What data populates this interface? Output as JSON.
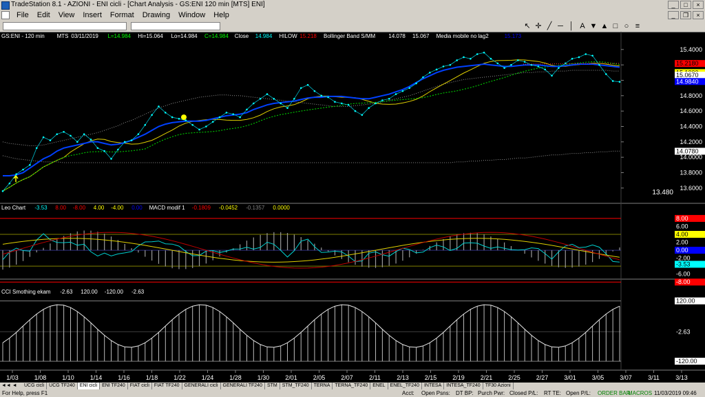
{
  "window": {
    "title": "TradeStation 8.1 - AZIONI - ENI cicli - [Chart Analysis - GS:ENI  120 min  [MTS] ENI]"
  },
  "menu": [
    "File",
    "Edit",
    "View",
    "Insert",
    "Format",
    "Drawing",
    "Window",
    "Help"
  ],
  "price_panel": {
    "header": [
      {
        "text": "GS:ENI - 120 min",
        "color": "#ffffff"
      },
      {
        "text": "MTS",
        "color": "#ffffff"
      },
      {
        "text": "03/11/2019",
        "color": "#ffffff"
      },
      {
        "text": "L=14.984",
        "color": "#00ff00"
      },
      {
        "text": "Hi=15.064",
        "color": "#ffffff"
      },
      {
        "text": "Lo=14.984",
        "color": "#ffffff"
      },
      {
        "text": "C=14.984",
        "color": "#00ff00"
      },
      {
        "text": "Close",
        "color": "#ffffff"
      },
      {
        "text": "14.984",
        "color": "#00ffff"
      },
      {
        "text": "HILOW",
        "color": "#ffffff"
      },
      {
        "text": "15.218",
        "color": "#ff0000"
      },
      {
        "text": "Bollinger Band S/MM",
        "color": "#ffffff"
      },
      {
        "text": "14.078",
        "color": "#ffffff"
      },
      {
        "text": "15.067",
        "color": "#ffffff"
      },
      {
        "text": "Media mobile no lag2",
        "color": "#ffffff"
      },
      {
        "text": "15.173",
        "color": "#0000ff"
      }
    ],
    "axis_ticks": [
      "15.4000",
      "15.2000",
      "15.0000",
      "14.8000",
      "14.6000",
      "14.4000",
      "14.2000",
      "14.0000",
      "13.8000",
      "13.6000"
    ],
    "markers": [
      {
        "text": "15.2180",
        "bg": "#ff0000",
        "fg": "#000000"
      },
      {
        "text": "15.1000",
        "bg": "#ffff00",
        "fg": "#000000"
      },
      {
        "text": "15.0670",
        "bg": "#ffffff",
        "fg": "#000000"
      },
      {
        "text": "14.9840",
        "bg": "#0000ff",
        "fg": "#ffffff"
      },
      {
        "text": "14.0780",
        "bg": "#ffffff",
        "fg": "#000000"
      }
    ],
    "bottom_label": "13.480"
  },
  "leo_panel": {
    "header": [
      {
        "text": "Leo Chart",
        "color": "#ffffff"
      },
      {
        "text": "-3.53",
        "color": "#00ffff"
      },
      {
        "text": "8.00",
        "color": "#ff0000"
      },
      {
        "text": "-8.00",
        "color": "#ff0000"
      },
      {
        "text": "4.00",
        "color": "#ffff00"
      },
      {
        "text": "-4.00",
        "color": "#ffff00"
      },
      {
        "text": "0.00",
        "color": "#0000ff"
      },
      {
        "text": "MACD modif 1",
        "color": "#ffffff"
      },
      {
        "text": "-0.1809",
        "color": "#ff0000"
      },
      {
        "text": "-0.0452",
        "color": "#ffff00"
      },
      {
        "text": "-0.1357",
        "color": "#808080"
      },
      {
        "text": "0.0000",
        "color": "#ffff00"
      }
    ],
    "markers": [
      {
        "text": "8.00",
        "bg": "#ff0000",
        "fg": "#ffffff"
      },
      {
        "text": "6.00",
        "bg": "#000000",
        "fg": "#ffffff"
      },
      {
        "text": "4.00",
        "bg": "#ffff00",
        "fg": "#000000"
      },
      {
        "text": "2.00",
        "bg": "#000000",
        "fg": "#ffffff"
      },
      {
        "text": "0.00",
        "bg": "#0000ff",
        "fg": "#ffffff"
      },
      {
        "text": "-2.00",
        "bg": "#000000",
        "fg": "#ffffff"
      },
      {
        "text": "-3.53",
        "bg": "#00ffff",
        "fg": "#000000"
      },
      {
        "text": "-6.00",
        "bg": "#000000",
        "fg": "#ffffff"
      },
      {
        "text": "-8.00",
        "bg": "#ff0000",
        "fg": "#ffffff"
      }
    ]
  },
  "cci_panel": {
    "header": [
      {
        "text": "CCI Smothing ekam",
        "color": "#ffffff"
      },
      {
        "text": "-2.63",
        "color": "#ffffff"
      },
      {
        "text": "120.00",
        "color": "#ffffff"
      },
      {
        "text": "-120.00",
        "color": "#ffffff"
      },
      {
        "text": "-2.63",
        "color": "#ffffff"
      }
    ],
    "markers": [
      {
        "text": "120.00",
        "bg": "#ffffff",
        "fg": "#000000"
      },
      {
        "text": "-2.63",
        "bg": "#000000",
        "fg": "#ffffff"
      },
      {
        "text": "-120.00",
        "bg": "#ffffff",
        "fg": "#000000"
      }
    ]
  },
  "date_ticks": [
    "1/03",
    "1/08",
    "1/10",
    "1/14",
    "1/16",
    "1/18",
    "1/22",
    "1/24",
    "1/28",
    "1/30",
    "2/01",
    "2/05",
    "2/07",
    "2/11",
    "2/13",
    "2/15",
    "2/19",
    "2/21",
    "2/25",
    "2/27",
    "3/01",
    "3/05",
    "3/07",
    "3/11",
    "3/13"
  ],
  "tabs": [
    "UCG cicli",
    "UCG TF240",
    "ENI cicli",
    "ENI TF240",
    "FIAT cicli",
    "FIAT TF240",
    "GENERALI cicli",
    "GENERALI TF240",
    "STM",
    "STM_TF240",
    "TERNA",
    "TERNA_TF240",
    "ENEL",
    "ENEL_TF240",
    "INTESA",
    "INTESA_TF240",
    "TF30 Azioni"
  ],
  "active_tab": "ENI cicli",
  "status": {
    "help": "For Help, press F1",
    "acct": "Acct:",
    "open_psns": "Open Psns:",
    "dt_bp": "DT BP:",
    "purch_pwr": "Purch Pwr:",
    "closed_pl": "Closed P/L:",
    "rt_te": "RT TE:",
    "open_pl": "Open P/L:",
    "order_bar": "ORDER BAR",
    "macros": "MACROS",
    "clock": "11/03/2019 09:46"
  },
  "chart_data": {
    "type": "line",
    "price_close": [
      13.56,
      13.66,
      13.78,
      13.84,
      13.9,
      14.12,
      14.26,
      14.22,
      14.3,
      14.33,
      14.28,
      14.2,
      14.3,
      14.23,
      14.12,
      14.08,
      13.98,
      14.1,
      14.2,
      14.22,
      14.3,
      14.42,
      14.55,
      14.66,
      14.58,
      14.52,
      14.5,
      14.48,
      14.42,
      14.36,
      14.4,
      14.46,
      14.52,
      14.58,
      14.56,
      14.52,
      14.62,
      14.7,
      14.76,
      14.82,
      14.76,
      14.7,
      14.64,
      14.76,
      14.9,
      14.94,
      14.86,
      14.8,
      14.78,
      14.72,
      14.7,
      14.68,
      14.6,
      14.55,
      14.64,
      14.7,
      14.74,
      14.76,
      14.82,
      14.86,
      14.9,
      14.96,
      15.04,
      15.1,
      15.14,
      15.18,
      15.2,
      15.26,
      15.3,
      15.28,
      15.34,
      15.36,
      15.28,
      15.22,
      15.16,
      15.2,
      15.26,
      15.24,
      15.2,
      15.18,
      15.14,
      15.06,
      15.16,
      15.22,
      15.28,
      15.3,
      15.34,
      15.32,
      15.2,
      15.08,
      14.99,
      14.98
    ],
    "mm_nolag": [
      13.76,
      13.76,
      13.77,
      13.8,
      13.86,
      13.92,
      13.98,
      14.02,
      14.08,
      14.12,
      14.14,
      14.16,
      14.18,
      14.2,
      14.2,
      14.18,
      14.16,
      14.17,
      14.19,
      14.22,
      14.26,
      14.3,
      14.35,
      14.4,
      14.43,
      14.45,
      14.46,
      14.47,
      14.47,
      14.47,
      14.48,
      14.5,
      14.52,
      14.54,
      14.55,
      14.56,
      14.58,
      14.62,
      14.65,
      14.68,
      14.7,
      14.71,
      14.72,
      14.73,
      14.75,
      14.77,
      14.78,
      14.78,
      14.79,
      14.79,
      14.79,
      14.78,
      14.77,
      14.76,
      14.76,
      14.78,
      14.8,
      14.82,
      14.85,
      14.88,
      14.92,
      14.97,
      15.02,
      15.06,
      15.1,
      15.13,
      15.15,
      15.17,
      15.18,
      15.19,
      15.2,
      15.21,
      15.2,
      15.19,
      15.18,
      15.18,
      15.19,
      15.2,
      15.2,
      15.2,
      15.19,
      15.18,
      15.18,
      15.19,
      15.2,
      15.21,
      15.21,
      15.21,
      15.2,
      15.19,
      15.18,
      15.17
    ],
    "bb_upper": [
      14.2,
      14.18,
      14.17,
      14.16,
      14.15,
      14.15,
      14.16,
      14.18,
      14.2,
      14.22,
      14.24,
      14.26,
      14.28,
      14.3,
      14.32,
      14.35,
      14.38,
      14.41,
      14.45,
      14.48,
      14.52,
      14.56,
      14.6,
      14.64,
      14.67,
      14.7,
      14.72,
      14.74,
      14.76,
      14.78,
      14.79,
      14.8,
      14.81,
      14.81,
      14.8,
      14.8,
      14.79,
      14.78,
      14.77,
      14.76,
      14.75,
      14.74,
      14.73,
      14.72,
      14.71,
      14.7,
      14.69,
      14.68,
      14.67,
      14.66,
      14.66,
      14.66,
      14.67,
      14.68,
      14.69,
      14.7,
      14.72,
      14.74,
      14.76,
      14.78,
      14.8,
      14.83,
      14.86,
      14.89,
      14.92,
      14.95,
      14.97,
      14.99,
      15.01,
      15.02,
      15.03,
      15.04,
      15.05,
      15.06,
      15.07,
      15.08,
      15.09,
      15.1,
      15.1,
      15.11,
      15.11,
      15.12,
      15.12,
      15.12,
      15.13,
      15.13,
      15.13,
      15.13,
      15.13,
      15.13,
      15.12,
      15.12
    ],
    "bb_lower": [
      14.02,
      14.0,
      13.98,
      13.97,
      13.96,
      13.95,
      13.94,
      13.94,
      13.94,
      13.93,
      13.93,
      13.93,
      13.93,
      13.93,
      13.93,
      13.93,
      13.93,
      13.93,
      13.93,
      13.93,
      13.93,
      13.93,
      13.93,
      13.93,
      13.93,
      13.93,
      13.93,
      13.93,
      13.93,
      13.93,
      13.93,
      13.93,
      13.93,
      13.93,
      13.93,
      13.93,
      13.93,
      13.93,
      13.93,
      13.93,
      13.93,
      13.93,
      13.93,
      13.93,
      13.93,
      13.93,
      13.93,
      13.93,
      13.93,
      13.93,
      13.93,
      13.93,
      13.93,
      13.93,
      13.93,
      13.93,
      13.93,
      13.93,
      13.93,
      13.93,
      13.93,
      13.93,
      13.93,
      13.93,
      13.93,
      13.93,
      13.93,
      13.94,
      13.94,
      13.95,
      13.95,
      13.96,
      13.96,
      13.97,
      13.97,
      13.98,
      13.99,
      13.99,
      14.0,
      14.01,
      14.02,
      14.03,
      14.03,
      14.04,
      14.05,
      14.05,
      14.06,
      14.06,
      14.07,
      14.07,
      14.08,
      14.08
    ],
    "price_ylim": [
      13.5,
      15.47
    ],
    "leo_ylim": [
      -9,
      9.2
    ],
    "cci_ylim": [
      -128,
      160
    ]
  }
}
